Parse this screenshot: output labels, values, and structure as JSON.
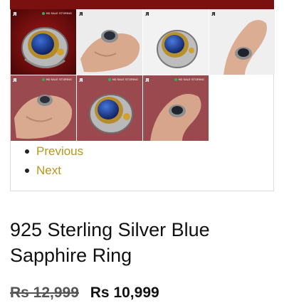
{
  "gallery": {
    "logo_text": "ᴙ",
    "badge_text": "HD SALE STORING",
    "thumbnails": [
      {
        "subject": "blue-sapphire-ring-front",
        "background": "#7a1212"
      },
      {
        "subject": "ring-on-hand",
        "background": "#e8e8e8"
      },
      {
        "subject": "blue-sapphire-ring-angle",
        "background": "#f0f0f0"
      },
      {
        "subject": "black-stone-ring-on-finger",
        "background": "#eeeeee"
      },
      {
        "subject": "ring-on-hand-maroon",
        "background": "#9a4a4f"
      },
      {
        "subject": "blue-sapphire-ring-maroon",
        "background": "#9a4a4f"
      },
      {
        "subject": "black-stone-ring-hand-maroon",
        "background": "#9a4a4f"
      }
    ]
  },
  "pagination": {
    "previous_label": "Previous",
    "next_label": "Next"
  },
  "product": {
    "title": "925 Sterling Silver Blue Sapphire Ring",
    "original_price": "Rs 12,999",
    "sale_price": "Rs 10,999"
  },
  "colors": {
    "accent_link": "#b8961e",
    "header_maroon": "#7a1010"
  }
}
